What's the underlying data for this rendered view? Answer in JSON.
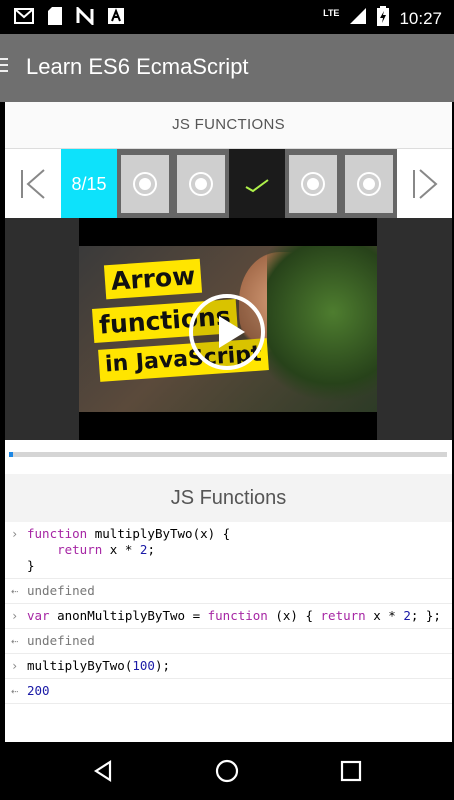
{
  "status_bar": {
    "time": "10:27",
    "network_label": "LTE",
    "left_icons": [
      "gmail-icon",
      "sd-card-icon",
      "n-app-icon",
      "a-app-icon"
    ],
    "right_icons": [
      "signal-icon",
      "battery-charging-icon"
    ]
  },
  "app_bar": {
    "title": "Learn ES6 EcmaScript"
  },
  "section": {
    "title": "JS FUNCTIONS"
  },
  "lesson_nav": {
    "counter": "8/15",
    "slots": [
      "lesson-slot",
      "lesson-slot",
      "current-lesson",
      "lesson-slot",
      "lesson-slot"
    ],
    "accent_color": "#0de2fb"
  },
  "video": {
    "thumbnail_lines": [
      "Arrow",
      "functions",
      "in JavaScript"
    ],
    "progress": 0.01,
    "progress_color": "#1e88e5"
  },
  "lesson": {
    "title": "JS Functions"
  },
  "console": {
    "lines": [
      {
        "type": "input",
        "text": "function multiplyByTwo(x) {\n    return x * 2;\n}"
      },
      {
        "type": "output",
        "text": "undefined"
      },
      {
        "type": "input",
        "text": "var anonMultiplyByTwo = function (x) { return x * 2; };"
      },
      {
        "type": "output",
        "text": "undefined"
      },
      {
        "type": "input",
        "text": "multiplyByTwo(100);"
      },
      {
        "type": "output",
        "text": "200"
      }
    ]
  },
  "nav_bar": {
    "buttons": [
      "back-icon",
      "home-icon",
      "recents-icon"
    ]
  }
}
